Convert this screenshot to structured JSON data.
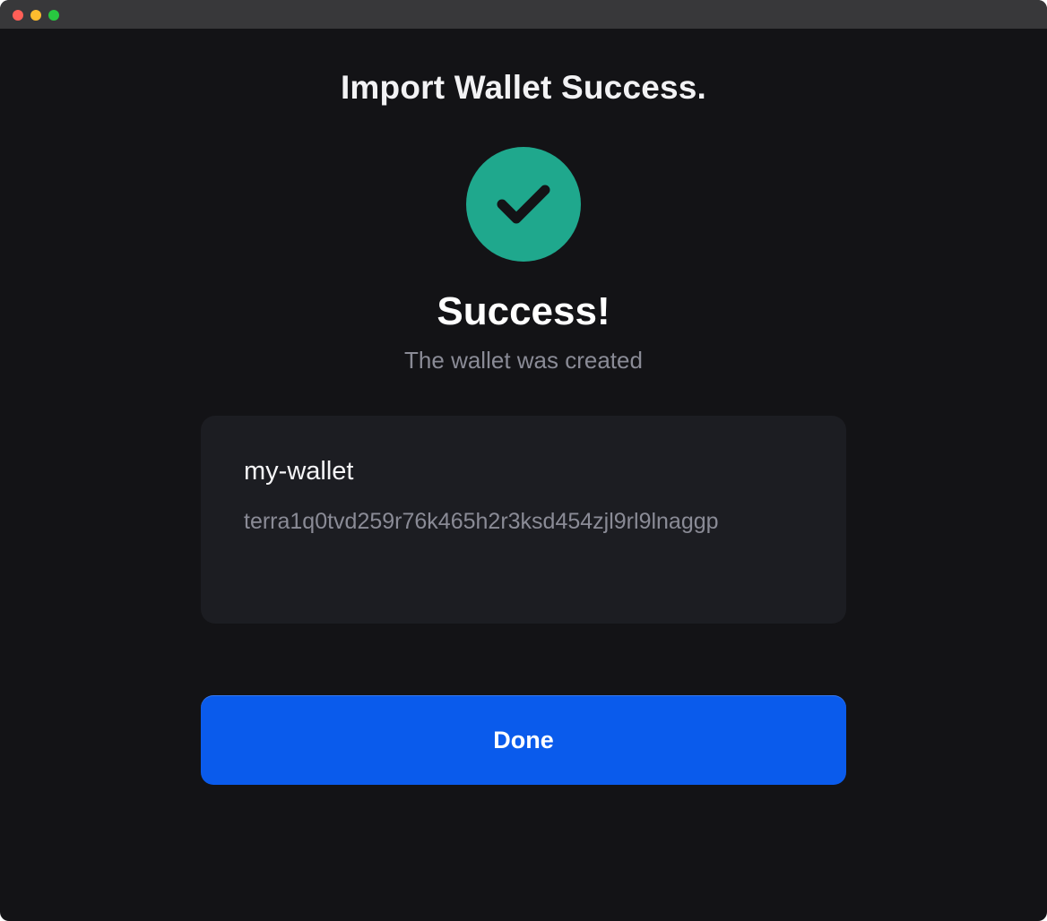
{
  "window": {
    "controls": [
      {
        "name": "close",
        "color": "#ff5f57"
      },
      {
        "name": "minimize",
        "color": "#febc2e"
      },
      {
        "name": "maximize",
        "color": "#28c840"
      }
    ]
  },
  "page": {
    "title": "Import Wallet Success."
  },
  "status": {
    "icon": "check-circle-icon",
    "icon_color": "#1fa88d",
    "heading": "Success!",
    "subtitle": "The wallet was created"
  },
  "wallet": {
    "name": "my-wallet",
    "address": "terra1q0tvd259r76k465h2r3ksd454zjl9rl9lnaggp"
  },
  "actions": {
    "done_label": "Done",
    "done_color": "#0a5bec"
  }
}
